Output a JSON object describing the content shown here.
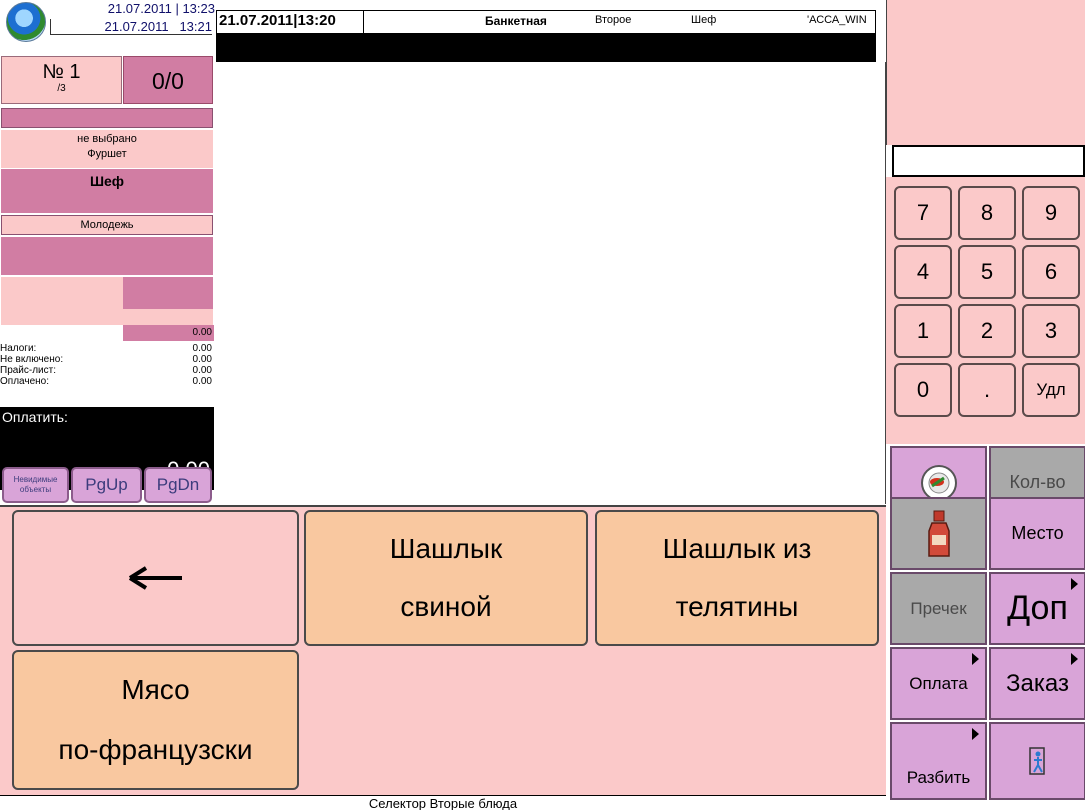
{
  "left": {
    "date_top": "21.07.2011",
    "time_top": "13:23",
    "date_bottom": "21.07.2011",
    "time_bottom": "13:21",
    "order_number": "№ 1",
    "order_sub": "/3",
    "counter": "0/0",
    "status": "не выбрано",
    "type": "Фуршет",
    "waiter": "Шеф",
    "category": "Молодежь",
    "subtotal": "0.00",
    "rows": [
      {
        "label": "Налоги:",
        "value": "0.00"
      },
      {
        "label": "Не включено:",
        "value": "0.00"
      },
      {
        "label": "Прайс-лист:",
        "value": "0.00"
      },
      {
        "label": "Оплачено:",
        "value": "0.00"
      }
    ],
    "pay_label": "Оплатить:",
    "pay_value": "0.00",
    "btn_objects": "Невидимые объекты",
    "btn_pgup": "PgUp",
    "btn_pgdn": "PgDn"
  },
  "header": {
    "date": "21.07.2011",
    "time": "13:20",
    "hall": "Банкетная",
    "course": "Второе",
    "user": "Шеф",
    "station": "'АССА_WIN"
  },
  "keypad": {
    "keys": [
      "7",
      "8",
      "9",
      "4",
      "5",
      "6",
      "1",
      "2",
      "3",
      "0",
      ".",
      "Удл"
    ]
  },
  "functions": {
    "qty": "Кол-во",
    "place": "Место",
    "precheck": "Пречек",
    "dop": "Доп",
    "payment": "Оплата",
    "order": "Заказ",
    "split": "Разбить"
  },
  "icons": {
    "dish": "dish-icon",
    "bottle": "bottle-icon",
    "exit": "person-exit-icon",
    "back": "left-arrow-icon"
  },
  "selector": {
    "back_glyph": "←",
    "dishes": [
      {
        "line1": "Шашлык",
        "line2": "свиной"
      },
      {
        "line1": "Шашлык из",
        "line2": "телятины"
      },
      {
        "line1": "Мясо",
        "line2": "по-французски"
      }
    ]
  },
  "status_bar": "Селектор Вторые блюда",
  "colors": {
    "pink": "#fbc9c9",
    "mauve": "#d17da3",
    "purple": "#d9a4d8",
    "dish": "#f9c8a0"
  }
}
